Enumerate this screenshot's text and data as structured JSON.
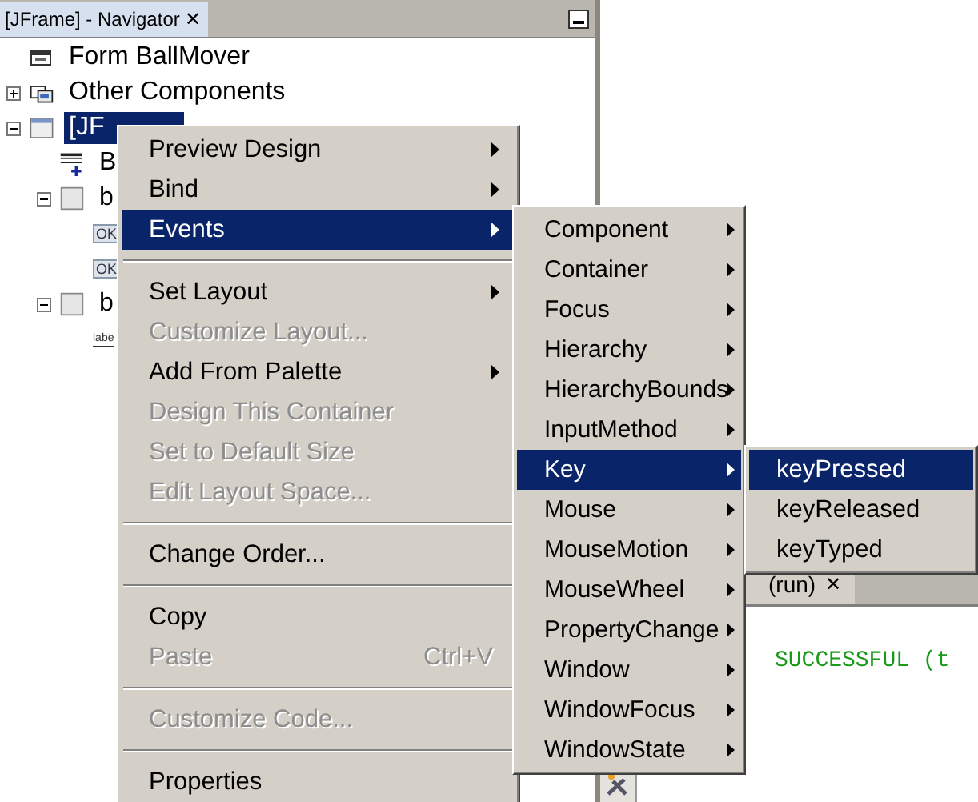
{
  "navigator": {
    "tab": {
      "title": "[JFrame] - Navigator",
      "close": "✕"
    },
    "tree": [
      {
        "kind": "form",
        "label": "Form BallMover",
        "selected": false
      },
      {
        "kind": "folder",
        "label": "Other Components",
        "selected": false,
        "expanded": false
      },
      {
        "kind": "frame",
        "label": "[JF",
        "selected": true,
        "expanded": true,
        "children": [
          {
            "kind": "menubar",
            "label": "B",
            "selected": false
          },
          {
            "kind": "panel",
            "label": "b",
            "selected": false,
            "expanded": true,
            "children": [
              {
                "kind": "button",
                "icon_text": "OK",
                "selected": false
              },
              {
                "kind": "button",
                "icon_text": "OK",
                "selected": false
              }
            ]
          },
          {
            "kind": "panel",
            "label": "b",
            "selected": false,
            "expanded": true,
            "children": [
              {
                "kind": "label",
                "icon_text": "labe",
                "selected": false
              }
            ]
          }
        ]
      }
    ]
  },
  "output": {
    "tab": {
      "title": "(run)",
      "close": "✕"
    },
    "text": "SUCCESSFUL (t"
  },
  "context_menu": [
    {
      "kind": "item",
      "label": "Preview Design",
      "submenu": true,
      "disabled": false,
      "selected": false
    },
    {
      "kind": "item",
      "label": "Bind",
      "submenu": true,
      "disabled": false,
      "selected": false
    },
    {
      "kind": "item",
      "label": "Events",
      "submenu": true,
      "disabled": false,
      "selected": true
    },
    {
      "kind": "separator"
    },
    {
      "kind": "item",
      "label": "Set Layout",
      "submenu": true,
      "disabled": false,
      "selected": false
    },
    {
      "kind": "item",
      "label": "Customize Layout...",
      "submenu": false,
      "disabled": true,
      "selected": false
    },
    {
      "kind": "item",
      "label": "Add From Palette",
      "submenu": true,
      "disabled": false,
      "selected": false
    },
    {
      "kind": "item",
      "label": "Design This Container",
      "submenu": false,
      "disabled": true,
      "selected": false
    },
    {
      "kind": "item",
      "label": "Set to Default Size",
      "submenu": false,
      "disabled": true,
      "selected": false
    },
    {
      "kind": "item",
      "label": "Edit Layout Space...",
      "submenu": false,
      "disabled": true,
      "selected": false
    },
    {
      "kind": "separator"
    },
    {
      "kind": "item",
      "label": "Change Order...",
      "submenu": false,
      "disabled": false,
      "selected": false
    },
    {
      "kind": "separator"
    },
    {
      "kind": "item",
      "label": "Copy",
      "submenu": false,
      "disabled": false,
      "selected": false
    },
    {
      "kind": "item",
      "label": "Paste",
      "submenu": false,
      "disabled": true,
      "selected": false,
      "shortcut": "Ctrl+V"
    },
    {
      "kind": "separator"
    },
    {
      "kind": "item",
      "label": "Customize Code...",
      "submenu": false,
      "disabled": true,
      "selected": false
    },
    {
      "kind": "separator"
    },
    {
      "kind": "item",
      "label": "Properties",
      "submenu": false,
      "disabled": false,
      "selected": false
    }
  ],
  "events_menu": [
    {
      "kind": "item",
      "label": "Component",
      "submenu": true,
      "disabled": false,
      "selected": false
    },
    {
      "kind": "item",
      "label": "Container",
      "submenu": true,
      "disabled": false,
      "selected": false
    },
    {
      "kind": "item",
      "label": "Focus",
      "submenu": true,
      "disabled": false,
      "selected": false
    },
    {
      "kind": "item",
      "label": "Hierarchy",
      "submenu": true,
      "disabled": false,
      "selected": false
    },
    {
      "kind": "item",
      "label": "HierarchyBounds",
      "submenu": true,
      "disabled": false,
      "selected": false
    },
    {
      "kind": "item",
      "label": "InputMethod",
      "submenu": true,
      "disabled": false,
      "selected": false
    },
    {
      "kind": "item",
      "label": "Key",
      "submenu": true,
      "disabled": false,
      "selected": true
    },
    {
      "kind": "item",
      "label": "Mouse",
      "submenu": true,
      "disabled": false,
      "selected": false
    },
    {
      "kind": "item",
      "label": "MouseMotion",
      "submenu": true,
      "disabled": false,
      "selected": false
    },
    {
      "kind": "item",
      "label": "MouseWheel",
      "submenu": true,
      "disabled": false,
      "selected": false
    },
    {
      "kind": "item",
      "label": "PropertyChange",
      "submenu": true,
      "disabled": false,
      "selected": false
    },
    {
      "kind": "item",
      "label": "Window",
      "submenu": true,
      "disabled": false,
      "selected": false
    },
    {
      "kind": "item",
      "label": "WindowFocus",
      "submenu": true,
      "disabled": false,
      "selected": false
    },
    {
      "kind": "item",
      "label": "WindowState",
      "submenu": true,
      "disabled": false,
      "selected": false
    }
  ],
  "key_menu": [
    {
      "kind": "item",
      "label": "keyPressed",
      "submenu": false,
      "disabled": false,
      "selected": true
    },
    {
      "kind": "item",
      "label": "keyReleased",
      "submenu": false,
      "disabled": false,
      "selected": false
    },
    {
      "kind": "item",
      "label": "keyTyped",
      "submenu": false,
      "disabled": false,
      "selected": false
    }
  ]
}
